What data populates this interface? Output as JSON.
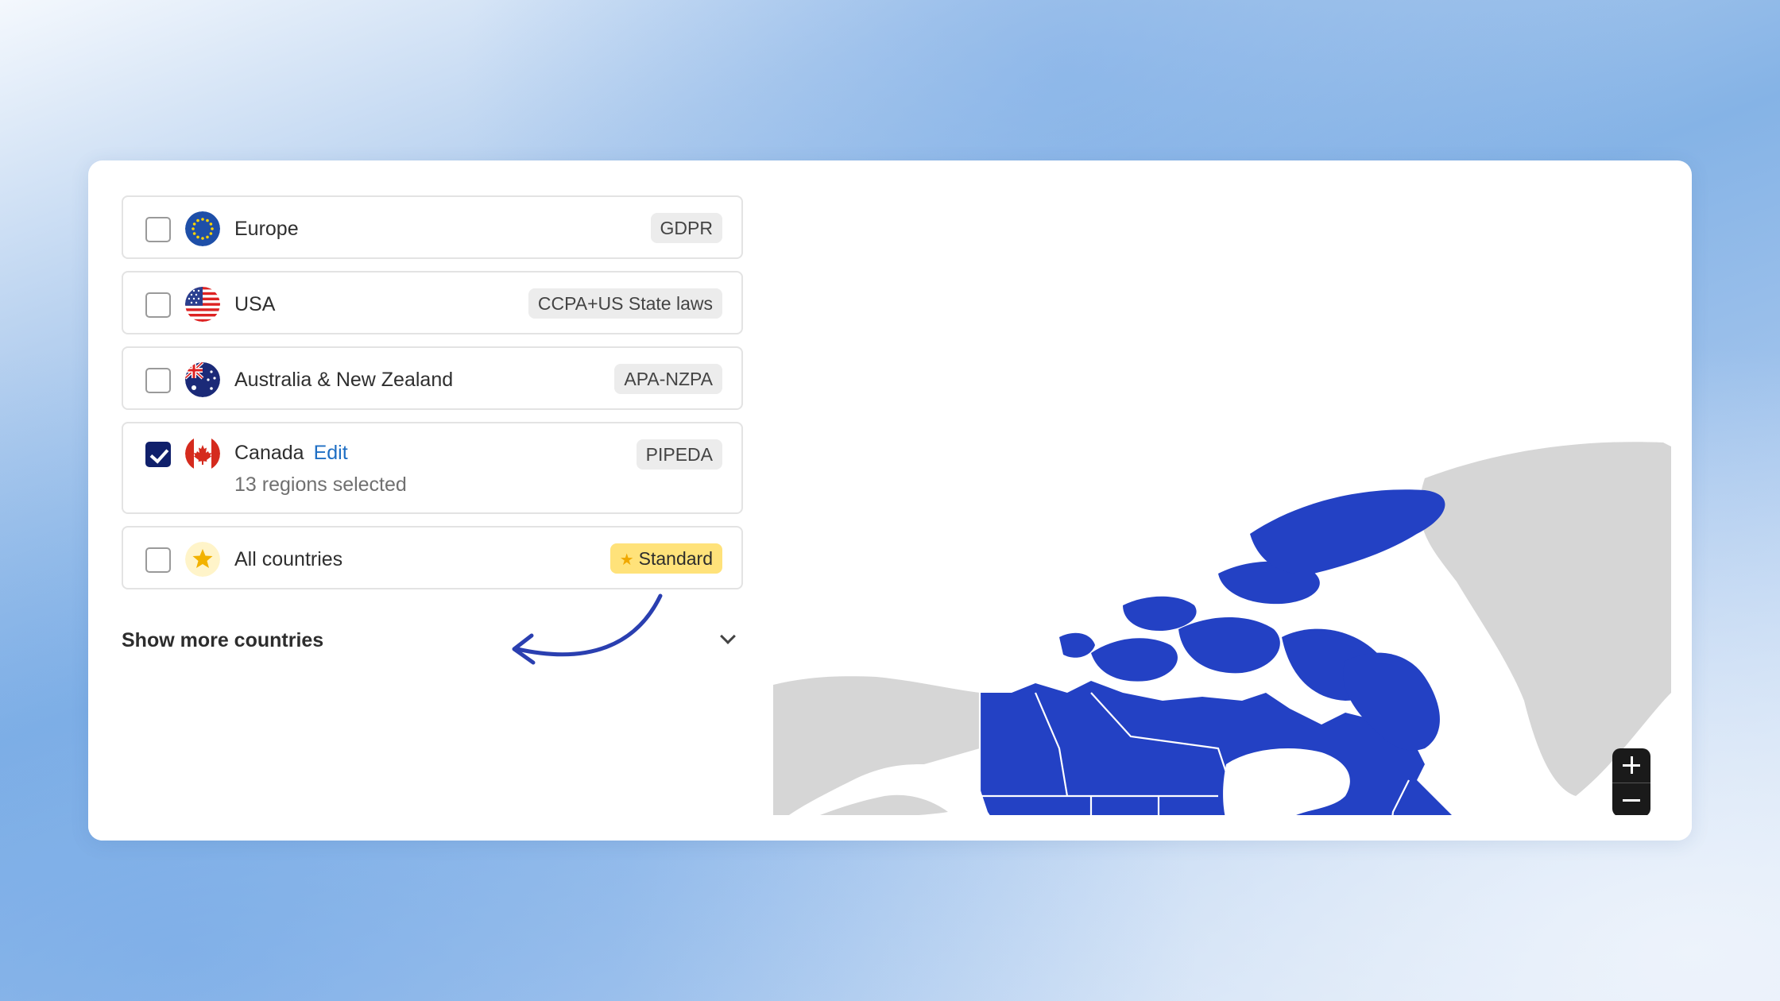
{
  "regions": [
    {
      "name": "Europe",
      "badge": "GDPR",
      "checked": false,
      "flag": "eu-flag-icon"
    },
    {
      "name": "USA",
      "badge": "CCPA+US State laws",
      "checked": false,
      "flag": "us-flag-icon"
    },
    {
      "name": "Australia & New Zealand",
      "badge": "APA-NZPA",
      "checked": false,
      "flag": "au-flag-icon"
    },
    {
      "name": "Canada",
      "edit_label": "Edit",
      "sub": "13 regions selected",
      "badge": "PIPEDA",
      "checked": true,
      "flag": "ca-flag-icon"
    },
    {
      "name": "All countries",
      "badge": "Standard",
      "checked": false,
      "flag": "star-icon"
    }
  ],
  "show_more_label": "Show more countries",
  "colors": {
    "selected_region": "#2341c4",
    "unselected_region": "#d6d6d6",
    "checkbox_checked": "#10206b",
    "link": "#1f6fc4",
    "standard_badge": "#ffe27a"
  }
}
